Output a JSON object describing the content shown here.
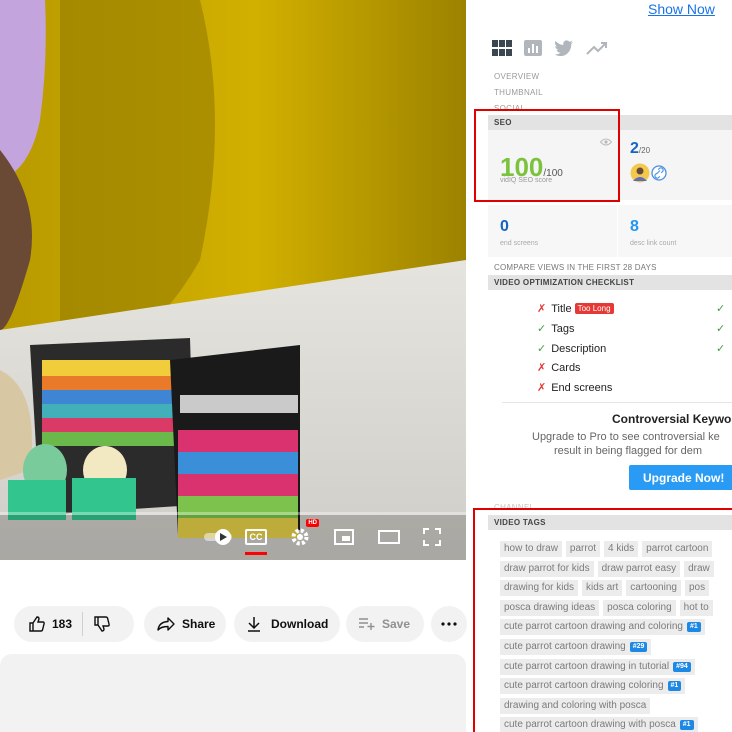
{
  "player": {
    "cc_label": "CC",
    "hd_badge": "HD"
  },
  "actions": {
    "like_count": "183",
    "share": "Share",
    "download": "Download",
    "save": "Save"
  },
  "panel": {
    "show_now": "Show Now",
    "nav": [
      "OVERVIEW",
      "THUMBNAIL",
      "SOCIAL"
    ],
    "seo_header": "SEO",
    "seo_score": "100",
    "seo_score_max": "/100",
    "seo_score_label": "vidIQ SEO score",
    "stat_a_value": "2",
    "stat_a_max": "/20",
    "end_screens_value": "0",
    "end_screens_label": "end screens",
    "desc_links_value": "8",
    "desc_links_label": "desc link count",
    "compare_views": "COMPARE VIEWS IN THE FIRST 28 DAYS",
    "checklist_header": "VIDEO OPTIMIZATION CHECKLIST",
    "checklist": [
      {
        "label": "Title",
        "status": "fail"
      },
      {
        "label": "Tags",
        "status": "pass"
      },
      {
        "label": "Description",
        "status": "pass"
      },
      {
        "label": "Cards",
        "status": "fail"
      },
      {
        "label": "End screens",
        "status": "fail"
      }
    ],
    "too_long": "Too Long",
    "controversial_title": "Controversial Keywo",
    "controversial_line1": "Upgrade to Pro to see controversial ke",
    "controversial_line2": "result in being flagged for dem",
    "upgrade_button": "Upgrade Now!",
    "channel_header": "CHANNEL",
    "video_tags_header": "VIDEO TAGS",
    "tag_rows": [
      [
        {
          "text": "how to draw"
        },
        {
          "text": "parrot"
        },
        {
          "text": "4 kids"
        },
        {
          "text": "parrot cartoon"
        }
      ],
      [
        {
          "text": "draw parrot for kids"
        },
        {
          "text": "draw parrot easy"
        },
        {
          "text": "draw"
        }
      ],
      [
        {
          "text": "drawing for kids"
        },
        {
          "text": "kids art"
        },
        {
          "text": "cartooning"
        },
        {
          "text": "pos"
        }
      ],
      [
        {
          "text": "posca drawing ideas"
        },
        {
          "text": "posca coloring"
        },
        {
          "text": "hot to"
        }
      ],
      [
        {
          "text": "cute parrot cartoon drawing and coloring",
          "rank": "#1"
        }
      ],
      [
        {
          "text": "cute parrot cartoon drawing",
          "rank": "#29"
        }
      ],
      [
        {
          "text": "cute parrot cartoon drawing in tutorial",
          "rank": "#94"
        }
      ],
      [
        {
          "text": "cute parrot cartoon drawing coloring",
          "rank": "#1"
        }
      ],
      [
        {
          "text": "drawing and coloring with posca"
        }
      ],
      [
        {
          "text": "cute parrot cartoon drawing with posca",
          "rank": "#1"
        }
      ]
    ]
  },
  "colors": {
    "seo_green": "#7bc23d",
    "stat_blue": "#1565c0",
    "fail_red": "#e53935",
    "pass_green": "#43a047",
    "upgrade_blue": "#2a9bf4",
    "highlight_red": "#e00000"
  }
}
